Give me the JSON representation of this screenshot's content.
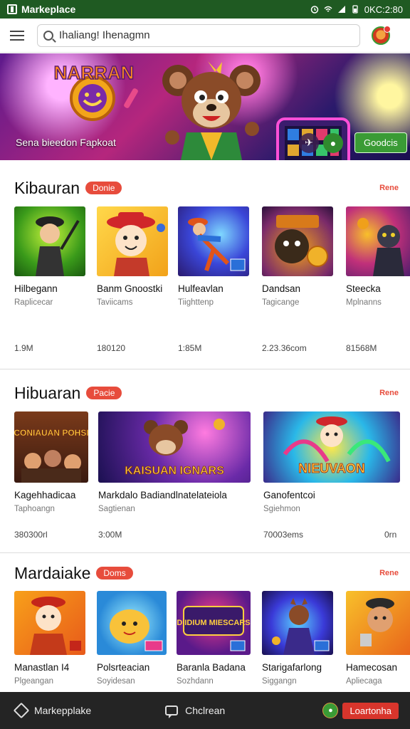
{
  "status_bar": {
    "title": "Markeplace",
    "time": "0KC:2:80"
  },
  "top_bar": {
    "search_value": "Ihaliang! Ihenagmn"
  },
  "banner": {
    "caption": "Sena bieedon Fapkoat",
    "cta": "Goodcis",
    "logo_text": "NARRAN"
  },
  "sections": [
    {
      "title": "Kibauran",
      "badge": "Donie",
      "more": "Rene",
      "cards": [
        {
          "title": "Hilbegann",
          "subtitle": "Raplicecar",
          "meta": "1.9M"
        },
        {
          "title": "Banm Gnoostki",
          "subtitle": "Taviicams",
          "meta": "180120"
        },
        {
          "title": "Hulfeavlan",
          "subtitle": "Tiighttenp",
          "meta": "1:85M"
        },
        {
          "title": "Dandsan",
          "subtitle": "Tagicange",
          "meta": "2.23.36com"
        },
        {
          "title": "Steecka",
          "subtitle": "Mplnanns",
          "meta": "81568M"
        }
      ]
    },
    {
      "title": "Hibuaran",
      "badge": "Pacie",
      "more": "Rene",
      "cards": [
        {
          "title": "Kagehhadicaa",
          "subtitle": "Taphoangn",
          "meta": "380300rl",
          "banner_text": "CONIAUAN POHSI"
        },
        {
          "title": "Markdalo Badiandlnatelateiola",
          "subtitle": "Sagtienan",
          "meta": "3:00M",
          "banner_text": "KAISUAN IGNARS"
        },
        {
          "title": "Ganofentcoi",
          "subtitle": "Sgiehmon",
          "meta": "70003ems",
          "banner_text": "NIEUVAON"
        },
        {
          "title": "",
          "subtitle": "",
          "meta": "0rn"
        }
      ]
    },
    {
      "title": "Mardaiake",
      "badge": "Doms",
      "more": "Rene",
      "cards": [
        {
          "title": "Manastlan I4",
          "subtitle": "Plgeangan"
        },
        {
          "title": "Polsrteacian",
          "subtitle": "Soyidesan"
        },
        {
          "title": "Baranla Badana",
          "subtitle": "Sozhdann",
          "banner_text": "DIIDIUM MIESCARS"
        },
        {
          "title": "Starigafarlong",
          "subtitle": "Siggangn"
        },
        {
          "title": "Hamecosan",
          "subtitle": "Apliecaga"
        }
      ]
    }
  ],
  "row1_extra_meta": "0rn",
  "bottom_nav": {
    "home_label": "Markepplake",
    "chat_label": "Chclrean",
    "cta": "Loartonha"
  }
}
